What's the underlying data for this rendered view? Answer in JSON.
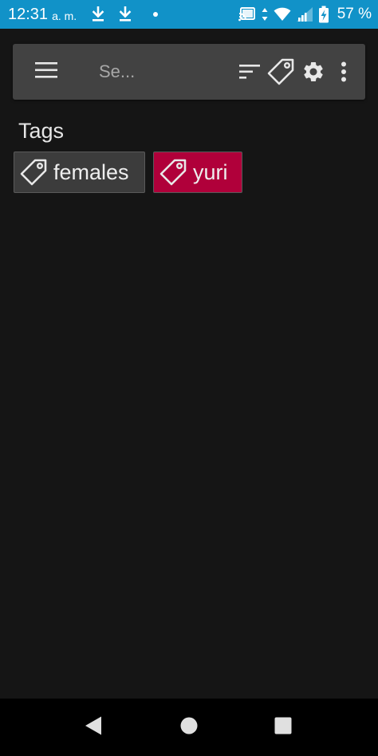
{
  "status_bar": {
    "time": "12:31",
    "ampm": "a. m.",
    "battery": "57 %",
    "icons": [
      "download-icon",
      "download-icon",
      "notification-dot",
      "cast-icon",
      "data-arrows-icon",
      "wifi-icon",
      "signal-icon",
      "battery-charging-icon"
    ],
    "background": "#1192c8"
  },
  "toolbar": {
    "search_placeholder": "Se...",
    "icons": [
      "menu-icon",
      "sort-icon",
      "tag-icon",
      "settings-icon",
      "more-vert-icon"
    ],
    "background": "#424242"
  },
  "content": {
    "section_title": "Tags",
    "tags": [
      {
        "label": "females",
        "color": "#3c3c3c"
      },
      {
        "label": "yuri",
        "color": "#b0003a"
      }
    ]
  },
  "nav_bar": {
    "icons": [
      "back-icon",
      "home-icon",
      "recents-icon"
    ]
  }
}
